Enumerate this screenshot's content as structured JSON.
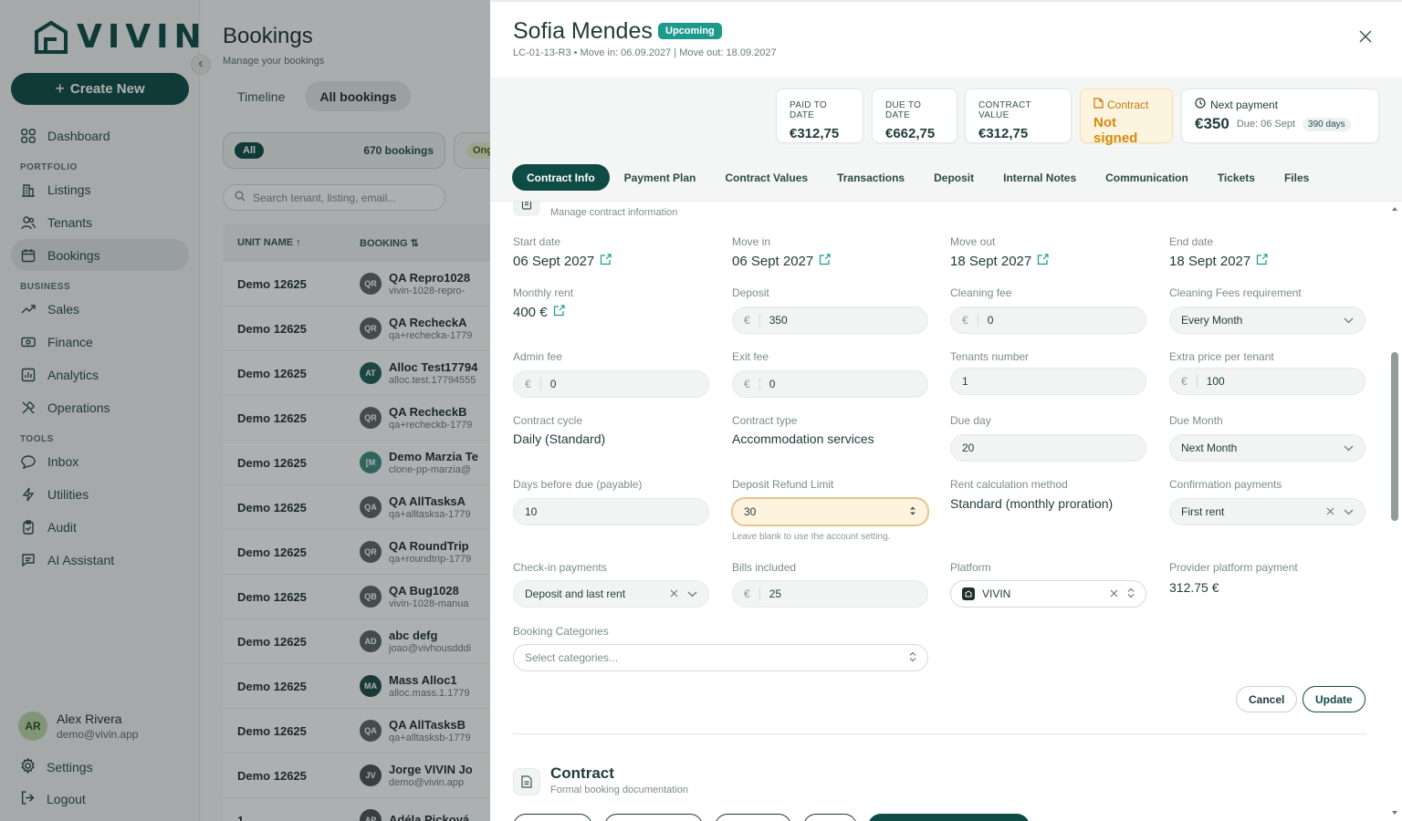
{
  "sidebar": {
    "logo_text": "VIVIN",
    "create_label": "Create New",
    "sections": {
      "portfolio": "PORTFOLIO",
      "business": "BUSINESS",
      "tools": "TOOLS"
    },
    "items": {
      "dashboard": "Dashboard",
      "listings": "Listings",
      "tenants": "Tenants",
      "bookings": "Bookings",
      "sales": "Sales",
      "finance": "Finance",
      "analytics": "Analytics",
      "operations": "Operations",
      "inbox": "Inbox",
      "utilities": "Utilities",
      "audit": "Audit",
      "ai_assistant": "AI Assistant"
    },
    "user": {
      "initials": "AR",
      "name": "Alex Rivera",
      "email": "demo@vivin.app"
    },
    "settings": "Settings",
    "logout": "Logout"
  },
  "bookings": {
    "title": "Bookings",
    "subtitle": "Manage your bookings",
    "tabs": [
      "Timeline",
      "All bookings"
    ],
    "filter_all": {
      "pill": "All",
      "count": "670 bookings"
    },
    "filter_ongoing": "Ong",
    "search_placeholder": "Search tenant, listing, email...",
    "columns": {
      "unit": "UNIT NAME ↑",
      "booking": "BOOKING ⇅"
    },
    "rows": [
      {
        "unit": "Demo 12625",
        "initials": "QR",
        "name": "QA Repro1028",
        "email": "vivin-1028-repro-"
      },
      {
        "unit": "Demo 12625",
        "initials": "QR",
        "name": "QA RecheckA",
        "email": "qa+rechecka-1779"
      },
      {
        "unit": "Demo 12625",
        "initials": "AT",
        "name": "Alloc Test17794",
        "email": "alloc.test.17794555"
      },
      {
        "unit": "Demo 12625",
        "initials": "QR",
        "name": "QA RecheckB",
        "email": "qa+recheckb-1779"
      },
      {
        "unit": "Demo 12625",
        "initials": "[M",
        "name": "Demo Marzia Te",
        "email": "clone-pp-marzia@"
      },
      {
        "unit": "Demo 12625",
        "initials": "QA",
        "name": "QA AllTasksA",
        "email": "qa+alltasksa-1779"
      },
      {
        "unit": "Demo 12625",
        "initials": "QR",
        "name": "QA RoundTrip",
        "email": "qa+roundtrip-1779"
      },
      {
        "unit": "Demo 12625",
        "initials": "QB",
        "name": "QA Bug1028",
        "email": "vivin-1028-manua"
      },
      {
        "unit": "Demo 12625",
        "initials": "AD",
        "name": "abc defg",
        "email": "joao@vivhousdddi"
      },
      {
        "unit": "Demo 12625",
        "initials": "MA",
        "name": "Mass Alloc1",
        "email": "alloc.mass.1.1779"
      },
      {
        "unit": "Demo 12625",
        "initials": "QA",
        "name": "QA AllTasksB",
        "email": "qa+alltasksb-1779"
      },
      {
        "unit": "Demo 12625",
        "initials": "JV",
        "name": "Jorge VIVIN Jo",
        "email": "demo@vivin.app"
      },
      {
        "unit": "1",
        "initials": "AP",
        "name": "Adéla Picková",
        "email": ""
      }
    ]
  },
  "drawer": {
    "tenant_name": "Sofia Mendes",
    "status_badge": "Upcoming",
    "subtitle": "LC-01-13-R3 • Move in: 06.09.2027 | Move out: 18.09.2027",
    "summary": {
      "paid_label": "PAID TO DATE",
      "paid_value": "€312,75",
      "due_label": "DUE TO DATE",
      "due_value": "€662,75",
      "contract_value_label": "CONTRACT VALUE",
      "contract_value": "€312,75",
      "contract_label": "Contract",
      "contract_status": "Not signed",
      "next_payment_label": "Next payment",
      "next_payment_amount": "€350",
      "next_payment_due": "Due: 06 Sept",
      "next_payment_days": "390 days"
    },
    "tabs": [
      "Contract Info",
      "Payment Plan",
      "Contract Values",
      "Transactions",
      "Deposit",
      "Internal Notes",
      "Communication",
      "Tickets",
      "Files"
    ],
    "section_subtitle": "Manage contract information",
    "fields": {
      "start_date_label": "Start date",
      "start_date": "06 Sept 2027",
      "move_in_label": "Move in",
      "move_in": "06 Sept 2027",
      "move_out_label": "Move out",
      "move_out": "18 Sept 2027",
      "end_date_label": "End date",
      "end_date": "18 Sept 2027",
      "monthly_rent_label": "Monthly rent",
      "monthly_rent": "400 €",
      "deposit_label": "Deposit",
      "deposit": "350",
      "cleaning_fee_label": "Cleaning fee",
      "cleaning_fee": "0",
      "cleaning_req_label": "Cleaning Fees requirement",
      "cleaning_req": "Every Month",
      "admin_fee_label": "Admin fee",
      "admin_fee": "0",
      "exit_fee_label": "Exit fee",
      "exit_fee": "0",
      "tenants_number_label": "Tenants number",
      "tenants_number": "1",
      "extra_price_label": "Extra price per tenant",
      "extra_price": "100",
      "contract_cycle_label": "Contract cycle",
      "contract_cycle": "Daily (Standard)",
      "contract_type_label": "Contract type",
      "contract_type": "Accommodation services",
      "due_day_label": "Due day",
      "due_day": "20",
      "due_month_label": "Due Month",
      "due_month": "Next Month",
      "days_before_due_label": "Days before due (payable)",
      "days_before_due": "10",
      "deposit_refund_label": "Deposit Refund Limit",
      "deposit_refund": "30",
      "deposit_refund_hint": "Leave blank to use the account setting.",
      "rent_calc_label": "Rent calculation method",
      "rent_calc": "Standard (monthly proration)",
      "confirmation_label": "Confirmation payments",
      "confirmation": "First rent",
      "checkin_label": "Check-in payments",
      "checkin": "Deposit and last rent",
      "bills_label": "Bills included",
      "bills": "25",
      "platform_label": "Platform",
      "platform": "VIVIN",
      "provider_label": "Provider platform payment",
      "provider": "312.75 €",
      "categories_label": "Booking Categories",
      "categories_placeholder": "Select categories..."
    },
    "currency": "€",
    "cancel_label": "Cancel",
    "update_label": "Update",
    "contract_section": {
      "title": "Contract",
      "subtitle": "Formal booking documentation"
    }
  },
  "colors": {
    "brand": "#0f4b45",
    "upcoming": "#1d9a8b",
    "warning": "#d58a0f"
  }
}
